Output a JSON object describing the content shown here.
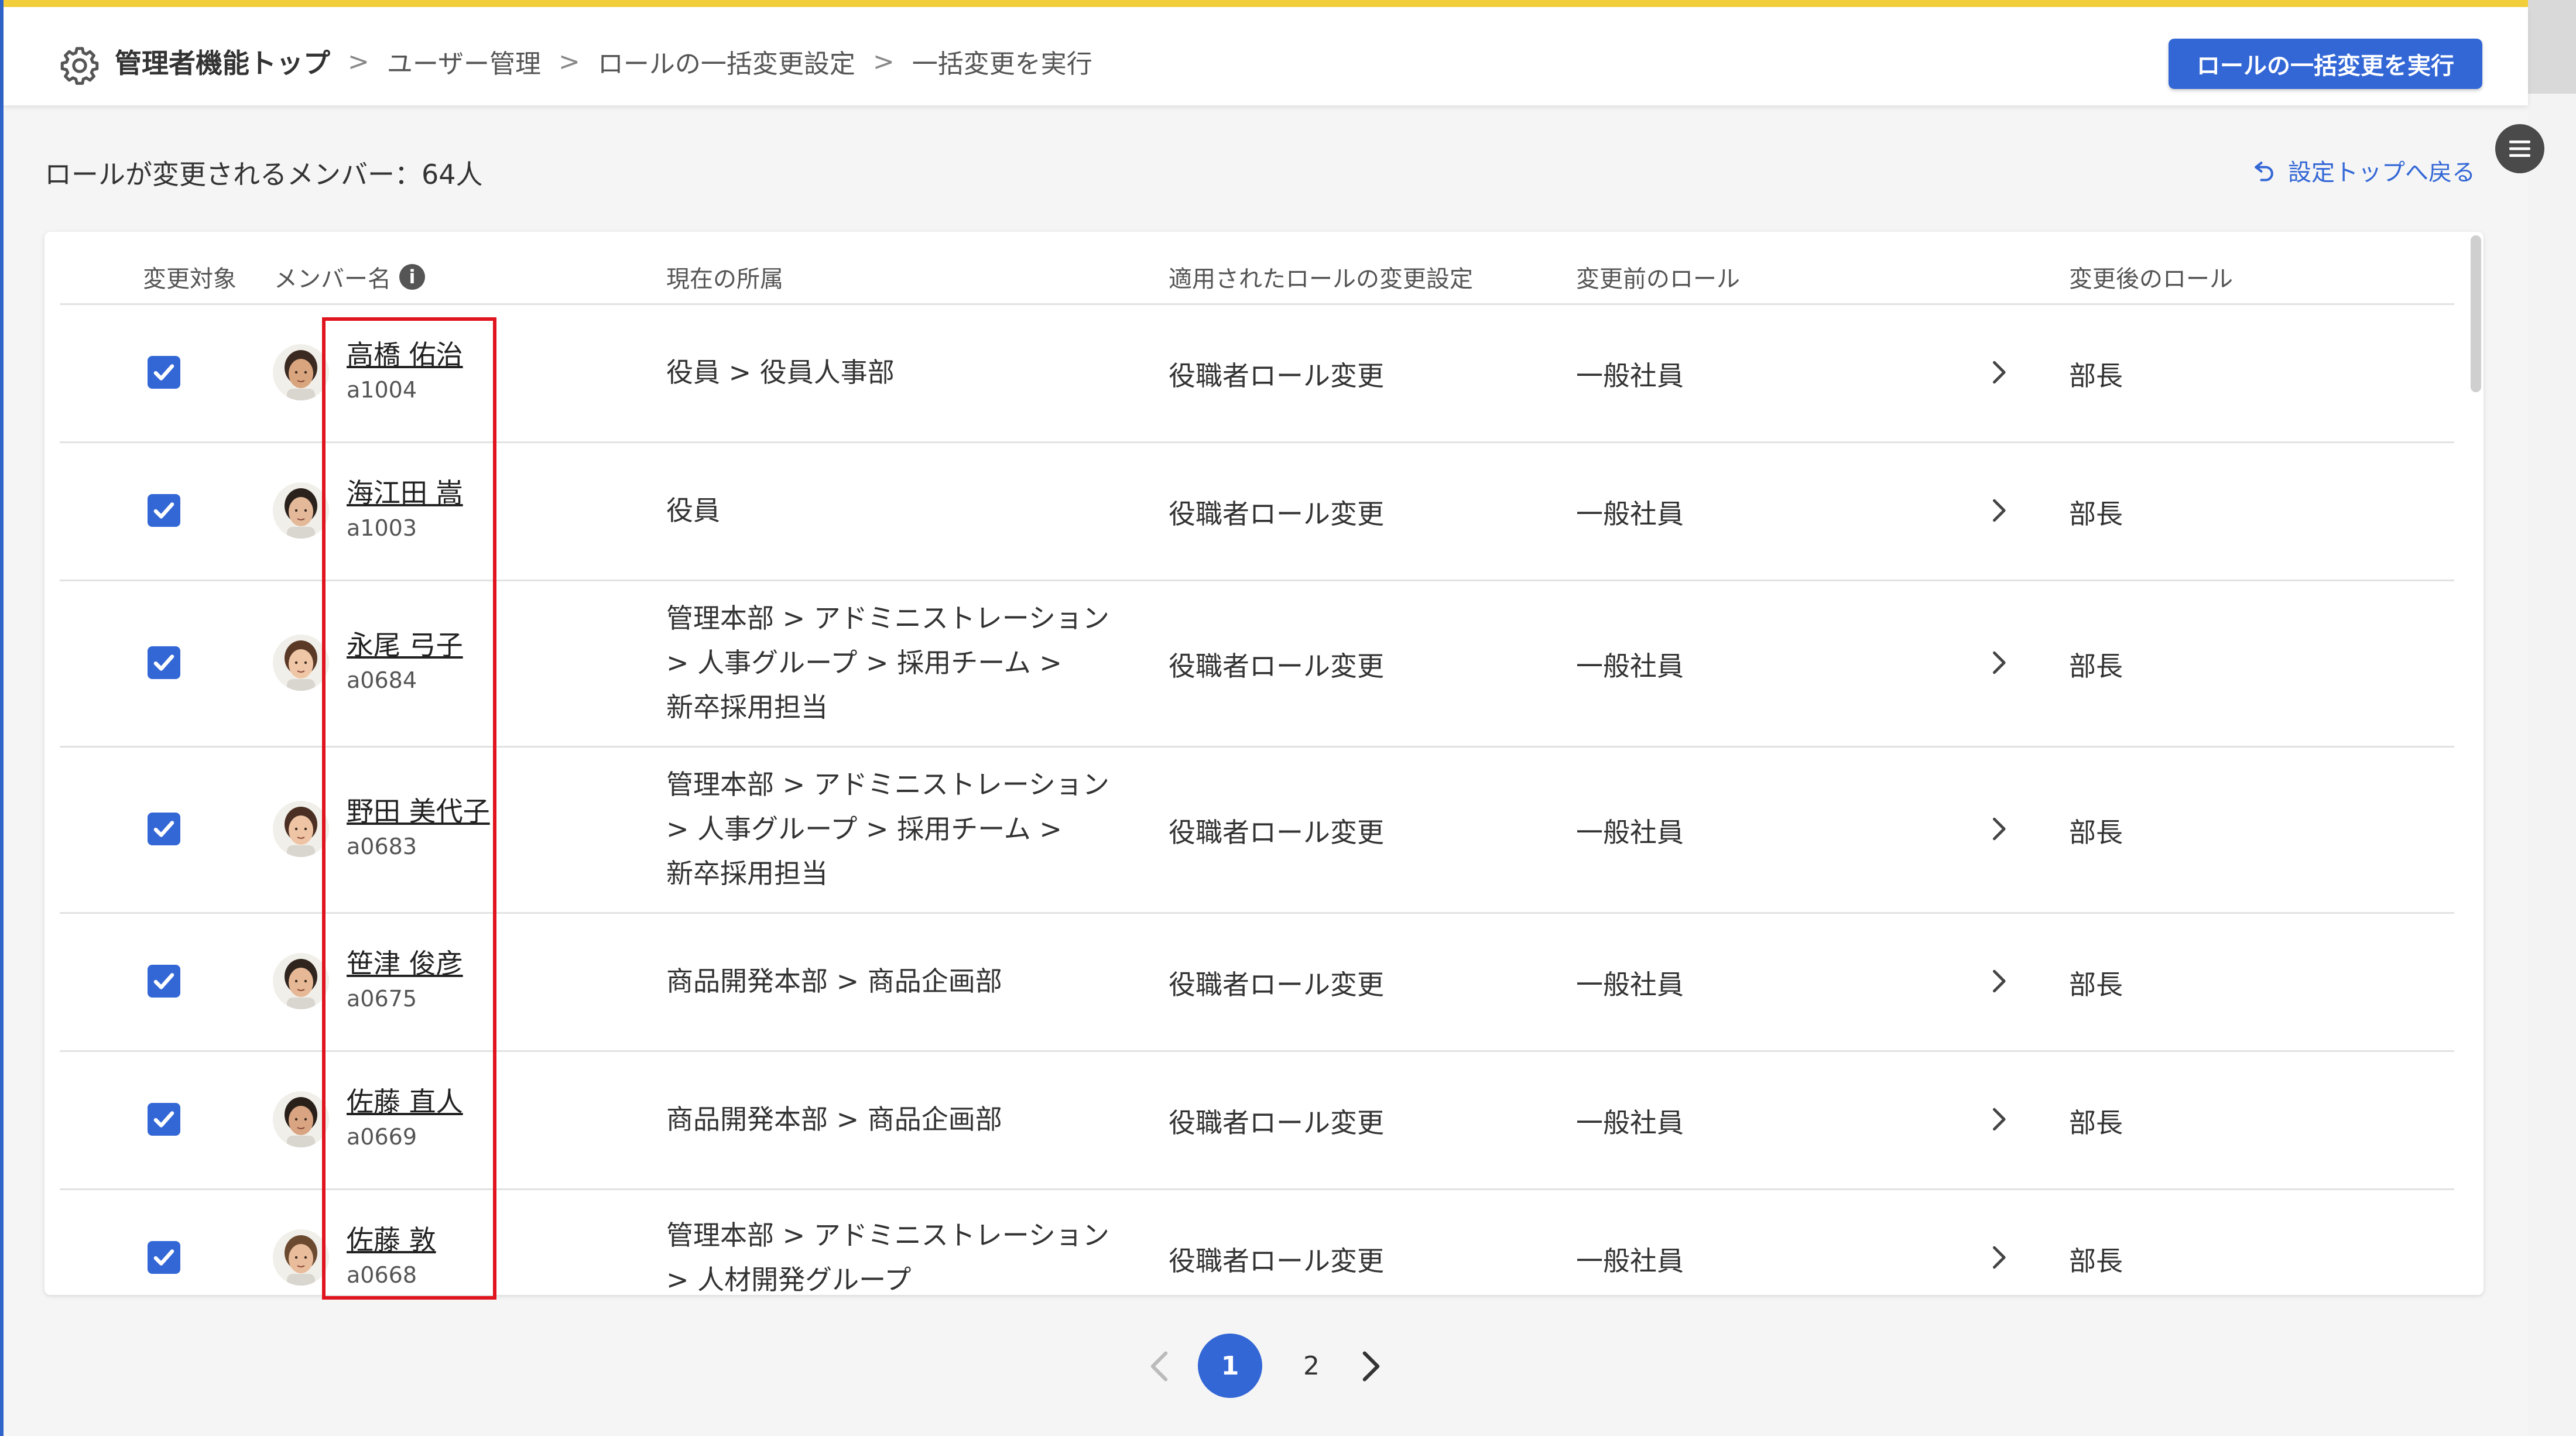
{
  "header": {
    "breadcrumb": [
      "管理者機能トップ",
      "ユーザー管理",
      "ロールの一括変更設定",
      "一括変更を実行"
    ],
    "primary_button": "ロールの一括変更を実行"
  },
  "summary": {
    "member_count": "ロールが変更されるメンバー：64人",
    "back_link": "設定トップへ戻る"
  },
  "table": {
    "columns": [
      "変更対象",
      "メンバー名",
      "現在の所属",
      "適用されたロールの変更設定",
      "変更前のロール",
      "変更後のロール"
    ],
    "member_info_icon": "i",
    "rows": [
      {
        "checked": true,
        "name": "高橋 佑治",
        "id": "a1004",
        "dept": [
          "役員 > 役員人事部"
        ],
        "setting": "役職者ロール変更",
        "before": "一般社員",
        "after": "部長"
      },
      {
        "checked": true,
        "name": "海江田 嵩",
        "id": "a1003",
        "dept": [
          "役員"
        ],
        "setting": "役職者ロール変更",
        "before": "一般社員",
        "after": "部長"
      },
      {
        "checked": true,
        "name": "永尾 弓子",
        "id": "a0684",
        "dept": [
          "管理本部 > アドミニストレーション",
          " > 人事グループ > 採用チーム >",
          "新卒採用担当"
        ],
        "setting": "役職者ロール変更",
        "before": "一般社員",
        "after": "部長"
      },
      {
        "checked": true,
        "name": "野田 美代子",
        "id": "a0683",
        "dept": [
          "管理本部 > アドミニストレーション",
          " > 人事グループ > 採用チーム >",
          "新卒採用担当"
        ],
        "setting": "役職者ロール変更",
        "before": "一般社員",
        "after": "部長"
      },
      {
        "checked": true,
        "name": "笹津 俊彦",
        "id": "a0675",
        "dept": [
          "商品開発本部 > 商品企画部"
        ],
        "setting": "役職者ロール変更",
        "before": "一般社員",
        "after": "部長"
      },
      {
        "checked": true,
        "name": "佐藤 直人",
        "id": "a0669",
        "dept": [
          "商品開発本部 > 商品企画部"
        ],
        "setting": "役職者ロール変更",
        "before": "一般社員",
        "after": "部長"
      },
      {
        "checked": true,
        "name": "佐藤 敦",
        "id": "a0668",
        "dept": [
          "管理本部 > アドミニストレーション",
          " > 人材開発グループ"
        ],
        "setting": "役職者ロール変更",
        "before": "一般社員",
        "after": "部長"
      }
    ]
  },
  "pagination": {
    "current": "1",
    "pages": [
      "1",
      "2"
    ]
  },
  "colors": {
    "accent": "#3367d6",
    "highlight": "#e0141e",
    "top_accent": "#f2cf3a"
  },
  "icons": {
    "settings": "gear-icon",
    "back": "undo-arrow-icon",
    "menu": "hamburger-icon",
    "row_arrow": "chevron-right-icon"
  }
}
